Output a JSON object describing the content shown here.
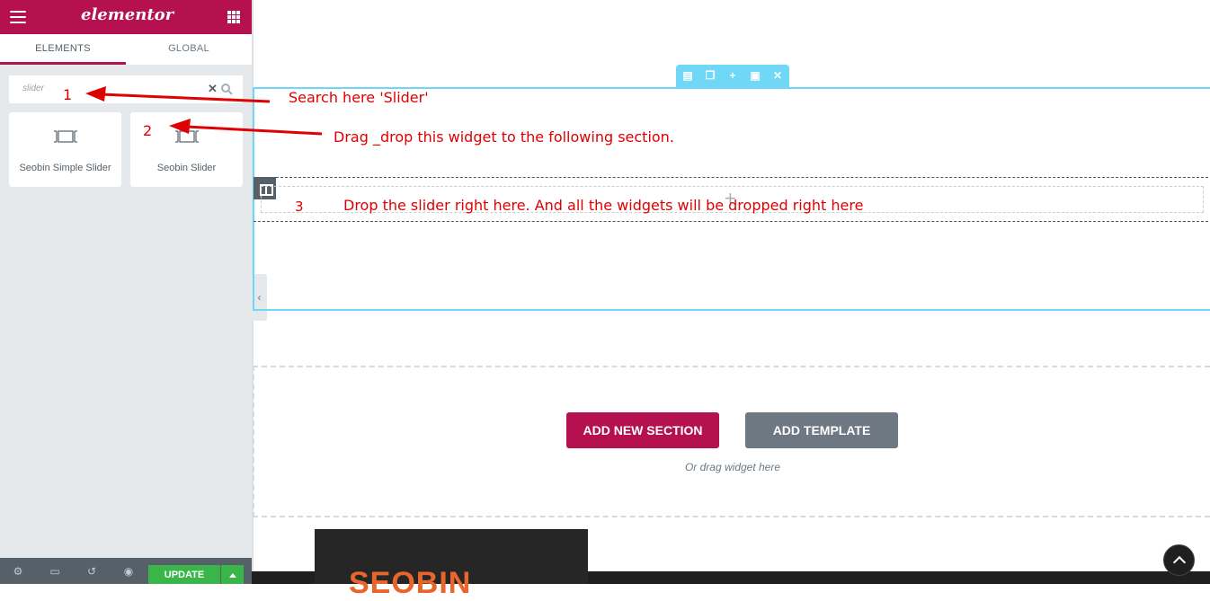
{
  "sidebar": {
    "logo": "elementor",
    "tabs": [
      {
        "label": "ELEMENTS",
        "active": true
      },
      {
        "label": "GLOBAL",
        "active": false
      }
    ],
    "search": {
      "value": "slider"
    },
    "widgets": [
      {
        "label": "Seobin Simple Slider",
        "icon": "slider-icon"
      },
      {
        "label": "Seobin Slider",
        "icon": "slider-icon"
      }
    ],
    "bottom": {
      "update_label": "UPDATE"
    }
  },
  "canvas": {
    "add_section_label": "ADD NEW SECTION",
    "add_template_label": "ADD TEMPLATE",
    "drag_hint": "Or drag widget here",
    "footer_logo": "SEOBIN"
  },
  "annotations": {
    "step1_number": "1",
    "step1_text": "Search here 'Slider'",
    "step2_number": "2",
    "step2_text": "Drag _drop this widget to the following section.",
    "step3_number": "3",
    "step3_text": "Drop the slider right here. And all the widgets will be dropped right here"
  },
  "colors": {
    "brand": "#b5104f",
    "update_green": "#39b54a",
    "section_outline": "#71d7f7",
    "annotation_red": "#e00000"
  }
}
